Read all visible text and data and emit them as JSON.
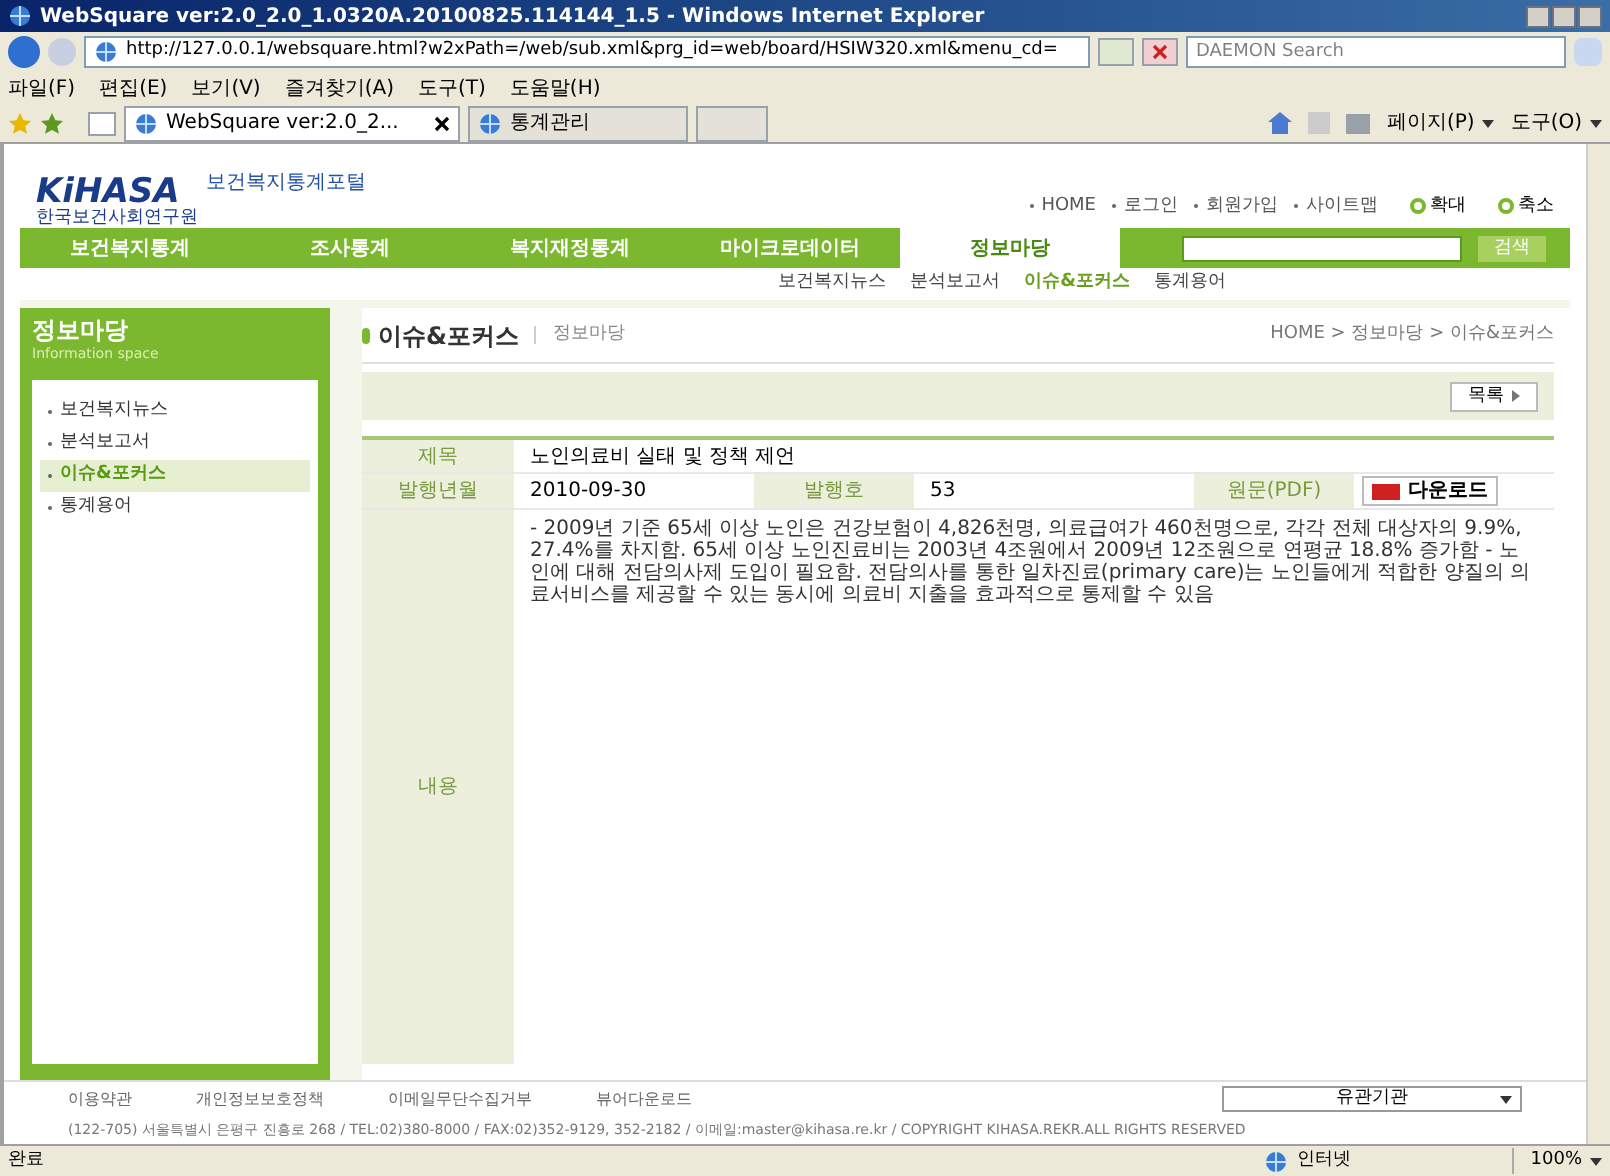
{
  "browser": {
    "title": "WebSquare ver:2.0_2.0_1.0320A.20100825.114144_1.5 - Windows Internet Explorer",
    "address": "http://127.0.0.1/websquare.html?w2xPath=/web/sub.xml&prg_id=web/board/HSIW320.xml&menu_cd=",
    "search_placeholder": "DAEMON Search",
    "menu": [
      "파일(F)",
      "편집(E)",
      "보기(V)",
      "즐겨찾기(A)",
      "도구(T)",
      "도움말(H)"
    ],
    "tabs": [
      {
        "label": "WebSquare ver:2.0_2...",
        "selected": true
      },
      {
        "label": "통계관리",
        "selected": false
      }
    ],
    "toolbar": [
      "페이지(P)",
      "도구(O)"
    ]
  },
  "site": {
    "logo": "KiHASA",
    "logo_sub": "한국보건사회연구원",
    "portal": "보건복지통계포털",
    "top_links": [
      "HOME",
      "로그인",
      "회원가입",
      "사이트맵"
    ],
    "zoom_buttons": [
      "확대",
      "축소"
    ],
    "nav": [
      {
        "label": "보건복지통계",
        "selected": false
      },
      {
        "label": "조사통계",
        "selected": false
      },
      {
        "label": "복지재정통계",
        "selected": false
      },
      {
        "label": "마이크로데이터",
        "selected": false
      },
      {
        "label": "정보마당",
        "selected": true
      }
    ],
    "search_button": "검색",
    "subnav": [
      {
        "label": "보건복지뉴스",
        "selected": false
      },
      {
        "label": "분석보고서",
        "selected": false
      },
      {
        "label": "이슈&포커스",
        "selected": true
      },
      {
        "label": "통계용어",
        "selected": false
      }
    ]
  },
  "sidebar": {
    "title": "정보마당",
    "subtitle": "Information space",
    "items": [
      {
        "label": "보건복지뉴스",
        "selected": false
      },
      {
        "label": "분석보고서",
        "selected": false
      },
      {
        "label": "이슈&포커스",
        "selected": true
      },
      {
        "label": "통계용어",
        "selected": false
      }
    ]
  },
  "main": {
    "title": "이슈&포커스",
    "section": "정보마당",
    "breadcrumb": "HOME > 정보마당 > 이슈&포커스",
    "list_button": "목록",
    "subject_label": "제목",
    "subject": "노인의료비 실태 및 정책 제언",
    "date_label": "발행년월",
    "date": "2010-09-30",
    "issue_label": "발행호",
    "issue": "53",
    "pdf_label": "원문(PDF)",
    "download": "다운로드",
    "content_label": "내용",
    "content": "- 2009년 기준 65세 이상 노인은 건강보험이 4,826천명, 의료급여가 460천명으로, 각각 전체 대상자의 9.9%, 27.4%를 차지함. 65세 이상 노인진료비는 2003년 4조원에서 2009년 12조원으로 연평균 18.8% 증가함 - 노인에 대해 전담의사제 도입이 필요함. 전담의사를 통한 일차진료(primary care)는 노인들에게 적합한 양질의 의료서비스를 제공할 수 있는 동시에 의료비 지출을 효과적으로 통제할 수 있음"
  },
  "footer": {
    "links": [
      "이용약관",
      "개인정보보호정책",
      "이메일무단수집거부",
      "뷰어다운로드"
    ],
    "related_select": "유관기관",
    "address": "(122-705) 서울특별시 은평구 진흥로 268 / TEL:02)380-8000 / FAX:02)352-9129, 352-2182 / 이메일:master@kihasa.re.kr / COPYRIGHT KIHASA.REKR.ALL RIGHTS RESERVED"
  },
  "status_bar": {
    "status": "완료",
    "zone": "인터넷",
    "zoom": "100%"
  }
}
